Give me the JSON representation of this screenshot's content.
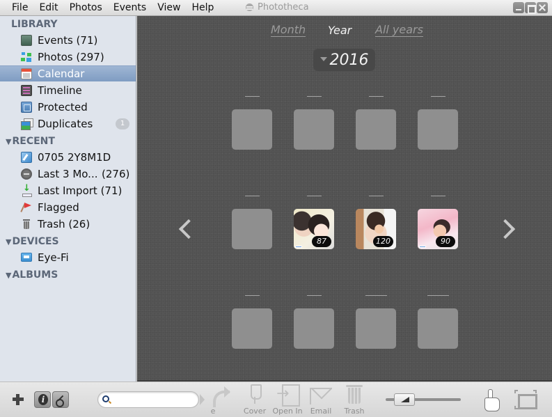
{
  "window": {
    "title": "Phototheca",
    "controls": [
      "minimize",
      "maximize",
      "close"
    ]
  },
  "menu": [
    "File",
    "Edit",
    "Photos",
    "Events",
    "View",
    "Help"
  ],
  "sidebar": {
    "library": {
      "header": "LIBRARY",
      "items": [
        {
          "label": "Events (71)",
          "icon": "events-icon"
        },
        {
          "label": "Photos (297)",
          "icon": "photos-icon"
        },
        {
          "label": "Calendar",
          "icon": "calendar-icon",
          "selected": true
        },
        {
          "label": "Timeline",
          "icon": "timeline-icon"
        },
        {
          "label": "Protected",
          "icon": "protected-icon"
        },
        {
          "label": "Duplicates",
          "icon": "duplicates-icon",
          "badge": "1"
        }
      ]
    },
    "recent": {
      "header": "RECENT",
      "items": [
        {
          "label": "0705 2Y8M1D",
          "icon": "album-icon"
        },
        {
          "label": "Last 3 Mo...",
          "count": "(276)",
          "icon": "clock-icon"
        },
        {
          "label": "Last Import (71)",
          "icon": "import-icon"
        },
        {
          "label": "Flagged",
          "icon": "flag-icon"
        },
        {
          "label": "Trash (26)",
          "icon": "trash-icon"
        }
      ]
    },
    "devices": {
      "header": "DEVICES",
      "items": [
        {
          "label": "Eye-Fi",
          "icon": "eyefi-icon"
        }
      ]
    },
    "albums": {
      "header": "ALBUMS"
    }
  },
  "calendar": {
    "tabs": {
      "month": "Month",
      "year": "Year",
      "all_years": "All years"
    },
    "active_tab": "Year",
    "year": "2016",
    "months": [
      {
        "label": "—",
        "count": null
      },
      {
        "label": "—",
        "count": null
      },
      {
        "label": "—",
        "count": null
      },
      {
        "label": "—",
        "count": null
      },
      {
        "label": "—",
        "count": null
      },
      {
        "label": "—",
        "count": "87"
      },
      {
        "label": "—",
        "count": "120"
      },
      {
        "label": "—",
        "count": "90"
      },
      {
        "label": "—",
        "count": null
      },
      {
        "label": "—",
        "count": null
      },
      {
        "label": "—",
        "count": null
      },
      {
        "label": "—",
        "count": null
      }
    ]
  },
  "toolbar": {
    "search_placeholder": "",
    "search_value": "",
    "actions": [
      {
        "label": "Share",
        "visible_label": "e"
      },
      {
        "label": "Cover"
      },
      {
        "label": "Open In"
      },
      {
        "label": "Email"
      },
      {
        "label": "Trash"
      }
    ],
    "zoom_level": 0.2
  }
}
